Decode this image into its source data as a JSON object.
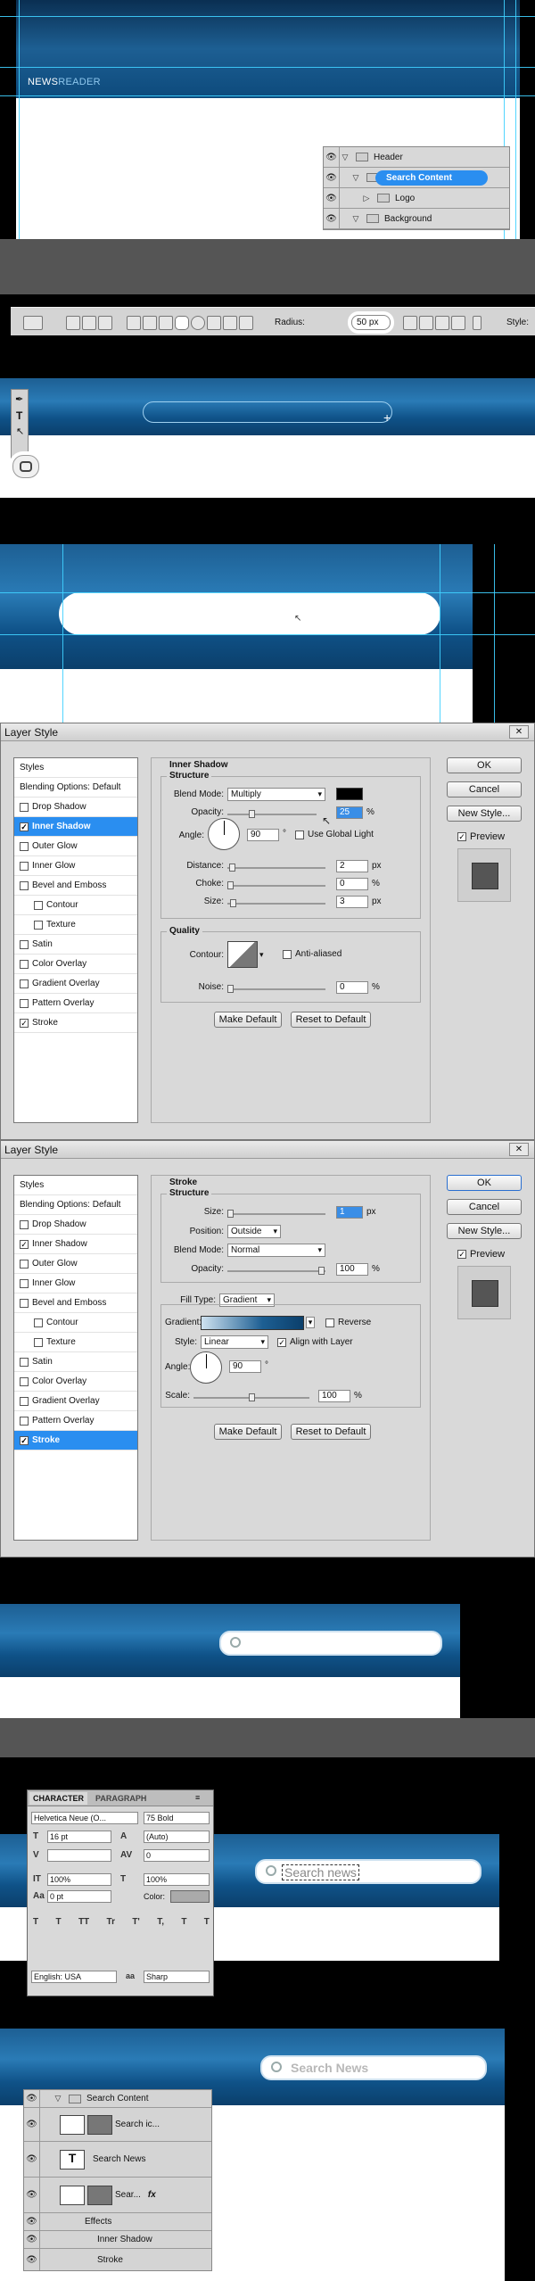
{
  "panel1": {
    "logo_main": "NEWS",
    "logo_accent": "READER",
    "layers": [
      {
        "name": "Header",
        "expanded": true,
        "selected": false
      },
      {
        "name": "Search Content",
        "expanded": true,
        "selected": true
      },
      {
        "name": "Logo",
        "expanded": false,
        "selected": false
      },
      {
        "name": "Background",
        "expanded": true,
        "selected": false
      }
    ]
  },
  "options_bar": {
    "radius_label": "Radius:",
    "radius_value": "50 px",
    "style_label": "Style:"
  },
  "layer_style_1": {
    "title": "Layer Style",
    "styles_header": "Styles",
    "blending": "Blending Options: Default",
    "items": [
      {
        "label": "Drop Shadow",
        "checked": false,
        "indent": false,
        "selected": false
      },
      {
        "label": "Inner Shadow",
        "checked": true,
        "indent": false,
        "selected": true
      },
      {
        "label": "Outer Glow",
        "checked": false,
        "indent": false,
        "selected": false
      },
      {
        "label": "Inner Glow",
        "checked": false,
        "indent": false,
        "selected": false
      },
      {
        "label": "Bevel and Emboss",
        "checked": false,
        "indent": false,
        "selected": false
      },
      {
        "label": "Contour",
        "checked": false,
        "indent": true,
        "selected": false
      },
      {
        "label": "Texture",
        "checked": false,
        "indent": true,
        "selected": false
      },
      {
        "label": "Satin",
        "checked": false,
        "indent": false,
        "selected": false
      },
      {
        "label": "Color Overlay",
        "checked": false,
        "indent": false,
        "selected": false
      },
      {
        "label": "Gradient Overlay",
        "checked": false,
        "indent": false,
        "selected": false
      },
      {
        "label": "Pattern Overlay",
        "checked": false,
        "indent": false,
        "selected": false
      },
      {
        "label": "Stroke",
        "checked": true,
        "indent": false,
        "selected": false
      }
    ],
    "section": "Inner Shadow",
    "structure": "Structure",
    "blend_mode_label": "Blend Mode:",
    "blend_mode": "Multiply",
    "opacity_label": "Opacity:",
    "opacity": "25",
    "angle_label": "Angle:",
    "angle": "90",
    "global_light": "Use Global Light",
    "distance_label": "Distance:",
    "distance": "2",
    "choke_label": "Choke:",
    "choke": "0",
    "size_label": "Size:",
    "size": "3",
    "quality": "Quality",
    "contour_label": "Contour:",
    "anti_aliased": "Anti-aliased",
    "noise_label": "Noise:",
    "noise": "0",
    "make_default": "Make Default",
    "reset_default": "Reset to Default",
    "ok": "OK",
    "cancel": "Cancel",
    "new_style": "New Style...",
    "preview": "Preview",
    "unit_pct": "%",
    "unit_px": "px",
    "unit_deg": "°"
  },
  "layer_style_2": {
    "title": "Layer Style",
    "styles_header": "Styles",
    "blending": "Blending Options: Default",
    "items": [
      {
        "label": "Drop Shadow",
        "checked": false,
        "indent": false,
        "selected": false
      },
      {
        "label": "Inner Shadow",
        "checked": true,
        "indent": false,
        "selected": false
      },
      {
        "label": "Outer Glow",
        "checked": false,
        "indent": false,
        "selected": false
      },
      {
        "label": "Inner Glow",
        "checked": false,
        "indent": false,
        "selected": false
      },
      {
        "label": "Bevel and Emboss",
        "checked": false,
        "indent": false,
        "selected": false
      },
      {
        "label": "Contour",
        "checked": false,
        "indent": true,
        "selected": false
      },
      {
        "label": "Texture",
        "checked": false,
        "indent": true,
        "selected": false
      },
      {
        "label": "Satin",
        "checked": false,
        "indent": false,
        "selected": false
      },
      {
        "label": "Color Overlay",
        "checked": false,
        "indent": false,
        "selected": false
      },
      {
        "label": "Gradient Overlay",
        "checked": false,
        "indent": false,
        "selected": false
      },
      {
        "label": "Pattern Overlay",
        "checked": false,
        "indent": false,
        "selected": false
      },
      {
        "label": "Stroke",
        "checked": true,
        "indent": false,
        "selected": true
      }
    ],
    "section": "Stroke",
    "structure": "Structure",
    "size_label": "Size:",
    "size": "1",
    "position_label": "Position:",
    "position": "Outside",
    "blend_mode_label": "Blend Mode:",
    "blend_mode": "Normal",
    "opacity_label": "Opacity:",
    "opacity": "100",
    "fill_type_label": "Fill Type:",
    "fill_type": "Gradient",
    "gradient_label": "Gradient:",
    "reverse": "Reverse",
    "style_label": "Style:",
    "style": "Linear",
    "align_layer": "Align with Layer",
    "angle_label": "Angle:",
    "angle": "90",
    "scale_label": "Scale:",
    "scale": "100",
    "make_default": "Make Default",
    "reset_default": "Reset to Default",
    "ok": "OK",
    "cancel": "Cancel",
    "new_style": "New Style...",
    "preview": "Preview",
    "unit_pct": "%",
    "unit_px": "px",
    "unit_deg": "°"
  },
  "character": {
    "tab_character": "CHARACTER",
    "tab_paragraph": "PARAGRAPH",
    "font_family": "Helvetica Neue (O...",
    "font_style": "75 Bold",
    "size": "16 pt",
    "leading": "(Auto)",
    "kerning": "",
    "tracking": "0",
    "v_scale": "100%",
    "h_scale": "100%",
    "baseline": "0 pt",
    "color_label": "Color:",
    "language": "English: USA",
    "aa_label": "aa",
    "antialias": "Sharp",
    "typo_buttons": [
      "T",
      "T",
      "TT",
      "Tr",
      "T'",
      "T,",
      "T",
      "T"
    ],
    "editing_text": "Search news"
  },
  "final": {
    "placeholder": "Search News",
    "layers": {
      "group": "Search Content",
      "icon_layer": "Search ic...",
      "text_layer": "Search News",
      "shape_layer": "Sear...",
      "fx": "fx",
      "effects": "Effects",
      "inner_shadow": "Inner Shadow",
      "stroke": "Stroke"
    }
  },
  "colors": {
    "blue_dark": "#0b3f6b",
    "blue_mid": "#2a7bb6",
    "selection": "#2a8ef0",
    "guide": "#3fd0ff"
  }
}
